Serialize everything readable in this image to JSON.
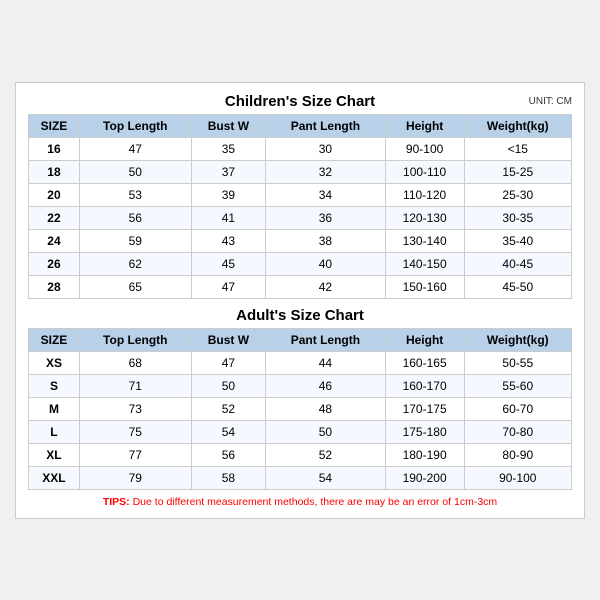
{
  "children_section": {
    "title": "Children's Size Chart",
    "unit": "UNIT: CM",
    "headers": [
      "SIZE",
      "Top Length",
      "Bust W",
      "Pant Length",
      "Height",
      "Weight(kg)"
    ],
    "rows": [
      [
        "16",
        "47",
        "35",
        "30",
        "90-100",
        "<15"
      ],
      [
        "18",
        "50",
        "37",
        "32",
        "100-110",
        "15-25"
      ],
      [
        "20",
        "53",
        "39",
        "34",
        "110-120",
        "25-30"
      ],
      [
        "22",
        "56",
        "41",
        "36",
        "120-130",
        "30-35"
      ],
      [
        "24",
        "59",
        "43",
        "38",
        "130-140",
        "35-40"
      ],
      [
        "26",
        "62",
        "45",
        "40",
        "140-150",
        "40-45"
      ],
      [
        "28",
        "65",
        "47",
        "42",
        "150-160",
        "45-50"
      ]
    ]
  },
  "adult_section": {
    "title": "Adult's Size Chart",
    "headers": [
      "SIZE",
      "Top Length",
      "Bust W",
      "Pant Length",
      "Height",
      "Weight(kg)"
    ],
    "rows": [
      [
        "XS",
        "68",
        "47",
        "44",
        "160-165",
        "50-55"
      ],
      [
        "S",
        "71",
        "50",
        "46",
        "160-170",
        "55-60"
      ],
      [
        "M",
        "73",
        "52",
        "48",
        "170-175",
        "60-70"
      ],
      [
        "L",
        "75",
        "54",
        "50",
        "175-180",
        "70-80"
      ],
      [
        "XL",
        "77",
        "56",
        "52",
        "180-190",
        "80-90"
      ],
      [
        "XXL",
        "79",
        "58",
        "54",
        "190-200",
        "90-100"
      ]
    ]
  },
  "tips": {
    "label": "TIPS:",
    "text": " Due to different measurement methods, there are may be an error of 1cm-3cm"
  }
}
